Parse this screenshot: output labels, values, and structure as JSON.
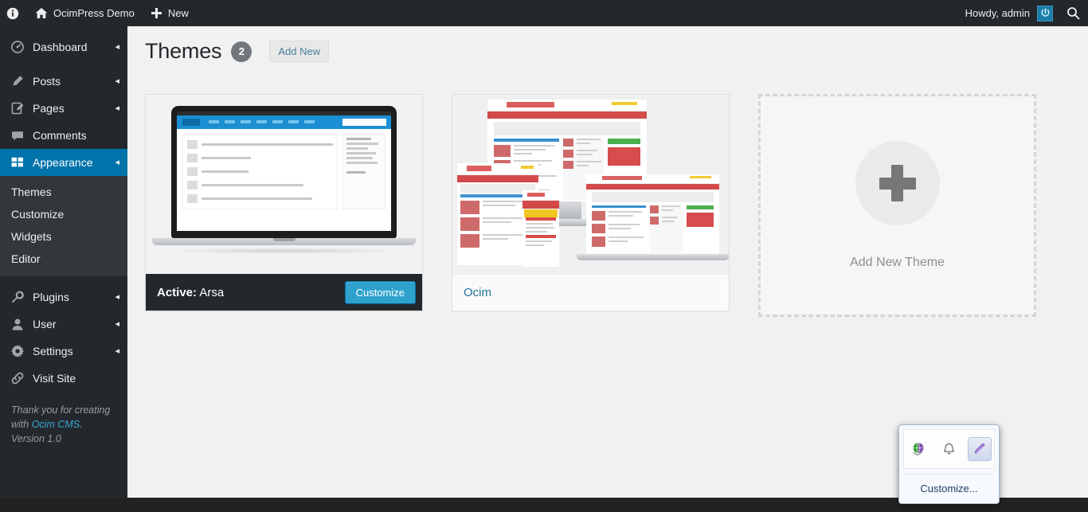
{
  "adminbar": {
    "info_icon": "info-icon",
    "home_icon": "home-icon",
    "site_title": "OcimPress Demo",
    "new_icon": "plus-icon",
    "new_label": "New",
    "howdy": "Howdy, admin",
    "avatar_icon": "power-avatar-icon",
    "search_icon": "search-icon"
  },
  "sidebar": {
    "items": [
      {
        "label": "Dashboard",
        "icon": "dashboard-icon",
        "arrow": "◂",
        "current": false
      },
      {
        "label": "Posts",
        "icon": "pencil-icon",
        "arrow": "◂",
        "current": false
      },
      {
        "label": "Pages",
        "icon": "page-edit-icon",
        "arrow": "◂",
        "current": false
      },
      {
        "label": "Comments",
        "icon": "comment-icon",
        "arrow": "",
        "current": false
      },
      {
        "label": "Appearance",
        "icon": "appearance-icon",
        "arrow": "◂",
        "current": true
      }
    ],
    "submenu": [
      "Themes",
      "Customize",
      "Widgets",
      "Editor"
    ],
    "items_lower": [
      {
        "label": "Plugins",
        "icon": "wrench-icon",
        "arrow": "◂"
      },
      {
        "label": "User",
        "icon": "user-icon",
        "arrow": "◂"
      },
      {
        "label": "Settings",
        "icon": "gear-icon",
        "arrow": "◂"
      },
      {
        "label": "Visit Site",
        "icon": "link-icon",
        "arrow": ""
      }
    ],
    "credit_before": "Thank you for creating with ",
    "credit_link": "Ocim CMS",
    "credit_after": ". Version 1.0"
  },
  "page": {
    "title": "Themes",
    "count": "2",
    "add_new_label": "Add New"
  },
  "themes": [
    {
      "name": "Arsa",
      "active_prefix": "Active:",
      "is_active": true,
      "customize_label": "Customize",
      "preview": "laptop-blog-mockup"
    },
    {
      "name": "Ocim",
      "is_active": false,
      "preview": "responsive-devices-mockup"
    }
  ],
  "add_theme": {
    "plus_icon": "plus-icon",
    "label": "Add New Theme"
  },
  "tray_popup": {
    "icons": [
      {
        "name": "network-globe-icon",
        "selected": false
      },
      {
        "name": "bell-icon",
        "selected": false
      },
      {
        "name": "pen-icon",
        "selected": true
      }
    ],
    "customize_label": "Customize..."
  },
  "colors": {
    "adminbar_bg": "#23282d",
    "sidebar_bg": "#23282d",
    "current_menu": "#0073aa",
    "accent_button": "#2ea2cc",
    "content_bg": "#f1f1f1",
    "link": "#21759b"
  }
}
